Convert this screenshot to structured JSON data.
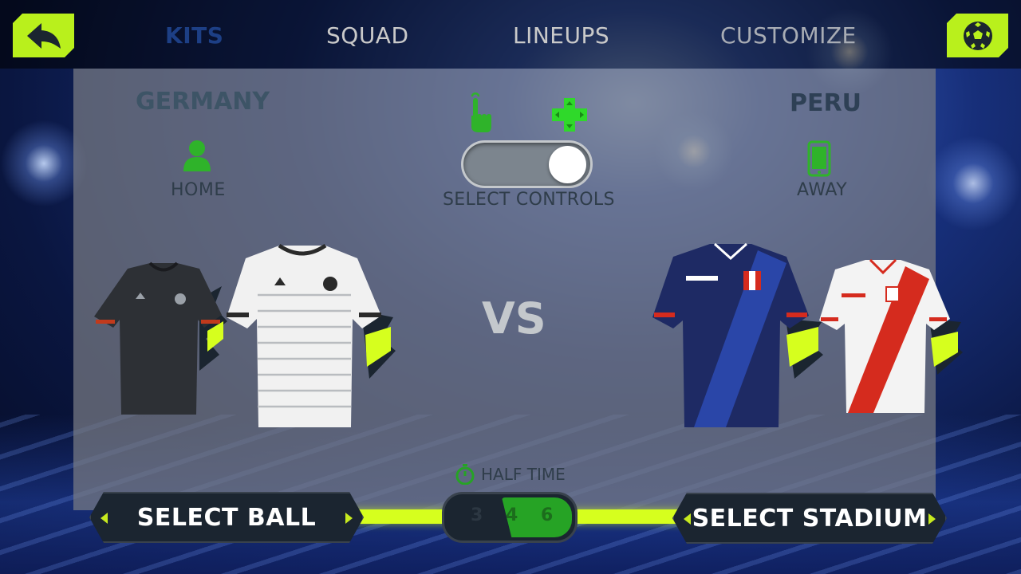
{
  "nav": {
    "tabs": [
      {
        "label": "KITS",
        "active": true
      },
      {
        "label": "SQUAD",
        "active": false
      },
      {
        "label": "LINEUPS",
        "active": false
      },
      {
        "label": "CUSTOMIZE",
        "active": false
      }
    ]
  },
  "home": {
    "team": "GERMANY",
    "side": "HOME",
    "icon": "person-icon",
    "kits": [
      "dark grey away kit",
      "white home kit"
    ]
  },
  "away": {
    "team": "PERU",
    "side": "AWAY",
    "icon": "phone-icon",
    "kits": [
      "navy away kit",
      "white home kit"
    ]
  },
  "controls": {
    "label": "SELECT CONTROLS",
    "toggle_on": true,
    "options": [
      "tap-icon",
      "dpad-icon"
    ]
  },
  "versus": "VS",
  "half_time": {
    "label": "HALF TIME",
    "options": [
      "3",
      "4",
      "6"
    ],
    "selected": "4"
  },
  "buttons": {
    "ball": "SELECT BALL",
    "stadium": "SELECT STADIUM"
  },
  "colors": {
    "accent": "#b9f01c",
    "green": "#26a325",
    "nav_active": "#1d3f85",
    "panel": "#787c84"
  }
}
